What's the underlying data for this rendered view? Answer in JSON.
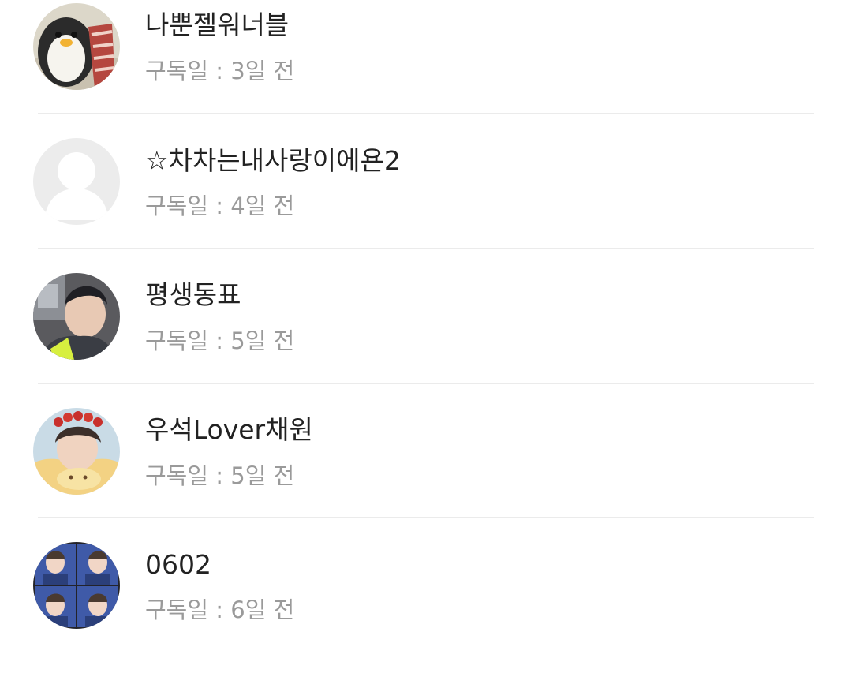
{
  "subscribers": [
    {
      "name": "나뿐젤워너블",
      "subscribed": "구독일 : 3일 전",
      "avatar_icon": "penguin-bacon-avatar-icon"
    },
    {
      "name": "☆차차는내사랑이에욘2",
      "subscribed": "구독일 : 4일 전",
      "avatar_icon": "default-person-avatar-icon"
    },
    {
      "name": "평생동표",
      "subscribed": "구독일 : 5일 전",
      "avatar_icon": "person-photo-avatar-icon"
    },
    {
      "name": "우석Lover채원",
      "subscribed": "구독일 : 5일 전",
      "avatar_icon": "person-flower-crown-avatar-icon"
    },
    {
      "name": "0602",
      "subscribed": "구독일 : 6일 전",
      "avatar_icon": "photo-grid-avatar-icon"
    }
  ],
  "colors": {
    "name_text": "#222222",
    "date_text": "#9a9a9a",
    "divider": "#ebebeb",
    "default_avatar_bg": "#ececec"
  }
}
